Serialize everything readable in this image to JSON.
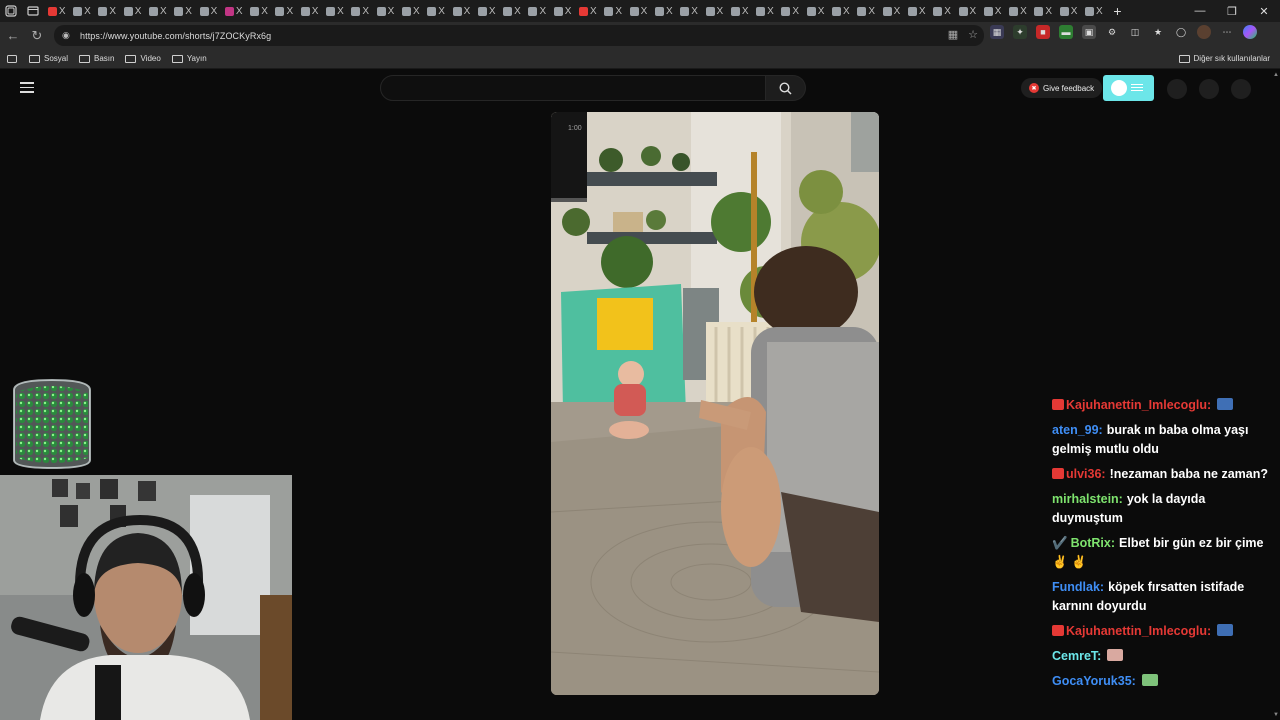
{
  "browser": {
    "url": "https://www.youtube.com/shorts/j7ZOCKyRx6g",
    "tab_close_glyph": "X",
    "new_tab_glyph": "+",
    "window_controls": [
      "—",
      "❐",
      "✕"
    ]
  },
  "bookmarks": {
    "items": [
      "Sosyal",
      "Basın",
      "Video",
      "Yayın"
    ],
    "other": "Diğer sık kullanılanlar"
  },
  "youtube": {
    "search_placeholder": "",
    "feedback_label": "Give feedback"
  },
  "video": {
    "timecode": "1:00"
  },
  "chat": [
    {
      "user": "Kajuhanettin_Imlecoglu:",
      "color": "#e53935",
      "badge": true,
      "text": "",
      "emote": true
    },
    {
      "user": "aten_99:",
      "color": "#3f8ef5",
      "badge": false,
      "text": "burak ın baba olma yaşı gelmiş mutlu oldu",
      "emote": false
    },
    {
      "user": "ulvi36:",
      "color": "#e53935",
      "badge": true,
      "text": "!nezaman baba ne zaman?",
      "emote": false
    },
    {
      "user": "mirhalstein:",
      "color": "#7ee36e",
      "badge": false,
      "text": "yok la dayıda duymuştum",
      "emote": false
    },
    {
      "user": "BotRix:",
      "color": "#7ee36e",
      "badge": false,
      "prefix": "✔️",
      "text": "Elbet bir gün ez bir çime ✌️ ✌️",
      "emote": false
    },
    {
      "user": "Fundlak:",
      "color": "#3f8ef5",
      "badge": false,
      "text": "köpek fırsatten istifade karnını doyurdu",
      "emote": false
    },
    {
      "user": "Kajuhanettin_Imlecoglu:",
      "color": "#e53935",
      "badge": true,
      "text": "",
      "emote": true
    },
    {
      "user": "CemreT:",
      "color": "#6ce6e9",
      "badge": false,
      "text": "",
      "emote": true
    },
    {
      "user": "GocaYoruk35:",
      "color": "#3f8ef5",
      "badge": false,
      "text": "",
      "emote": true
    }
  ],
  "colors": {
    "accent_toggle": "#6ce6e9",
    "feedback_icon": "#e53935"
  }
}
